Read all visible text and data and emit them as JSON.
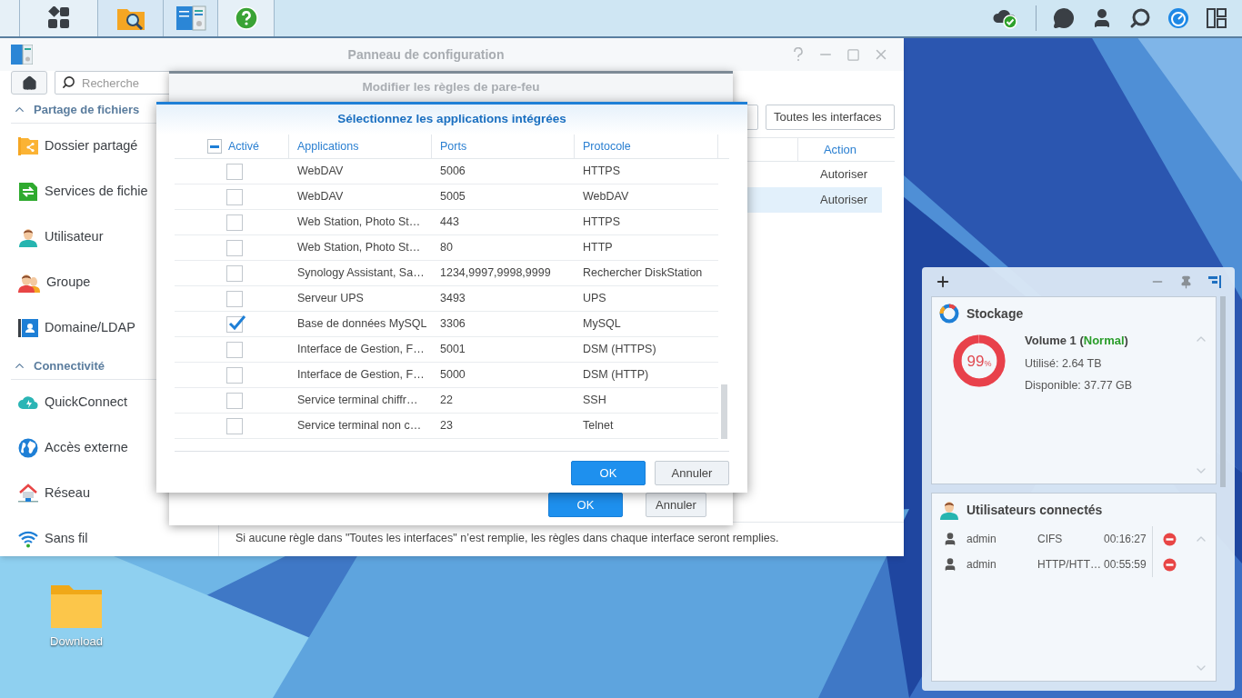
{
  "control_panel": {
    "title": "Panneau de configuration",
    "search": {
      "placeholder": "Recherche"
    },
    "sidebar": [
      {
        "label": "Partage de fichiers",
        "expanded": true,
        "items": [
          {
            "label": "Dossier partagé"
          },
          {
            "label": "Services de fichie"
          },
          {
            "label": "Utilisateur"
          },
          {
            "label": "Groupe"
          },
          {
            "label": "Domaine/LDAP"
          }
        ]
      },
      {
        "label": "Connectivité",
        "expanded": true,
        "items": [
          {
            "label": "QuickConnect"
          },
          {
            "label": "Accès externe"
          },
          {
            "label": "Réseau"
          },
          {
            "label": "Sans fil"
          }
        ]
      }
    ],
    "interface_filter": "Toutes les interfaces",
    "rules": {
      "columns": [
        "Action"
      ],
      "rows": [
        {
          "action": "Autoriser",
          "selected": false
        },
        {
          "action": "Autoriser",
          "selected": true
        }
      ]
    },
    "note": "Si aucune règle dans \"Toutes les interfaces\" n’est remplie, les règles dans chaque interface seront remplies."
  },
  "firewall_dialog": {
    "title": "Modifier les règles de pare-feu",
    "buttons": [
      {
        "label": "OK",
        "kind": "primary"
      },
      {
        "label": "Annuler",
        "kind": "secondary"
      }
    ]
  },
  "apps_dialog": {
    "title": "Sélectionnez les applications intégrées",
    "select_all": {
      "indeterminate": true
    },
    "columns": [
      "Activé",
      "Applications",
      "Ports",
      "Protocole"
    ],
    "rows": [
      {
        "checked": false,
        "application": "WebDAV",
        "ports": "5006",
        "protocol": "HTTPS"
      },
      {
        "checked": false,
        "application": "WebDAV",
        "ports": "5005",
        "protocol": "WebDAV"
      },
      {
        "checked": false,
        "application": "Web Station, Photo St…",
        "ports": "443",
        "protocol": "HTTPS"
      },
      {
        "checked": false,
        "application": "Web Station, Photo St…",
        "ports": "80",
        "protocol": "HTTP"
      },
      {
        "checked": false,
        "application": "Synology Assistant, Sa…",
        "ports": "1234,9997,9998,9999",
        "protocol": "Rechercher DiskStation"
      },
      {
        "checked": false,
        "application": "Serveur UPS",
        "ports": "3493",
        "protocol": "UPS"
      },
      {
        "checked": true,
        "application": "Base de données MySQL",
        "ports": "3306",
        "protocol": "MySQL"
      },
      {
        "checked": false,
        "application": "Interface de Gestion, F…",
        "ports": "5001",
        "protocol": "DSM (HTTPS)"
      },
      {
        "checked": false,
        "application": "Interface de Gestion, F…",
        "ports": "5000",
        "protocol": "DSM (HTTP)"
      },
      {
        "checked": false,
        "application": "Service terminal chiffr…",
        "ports": "22",
        "protocol": "SSH"
      },
      {
        "checked": false,
        "application": "Service terminal non c…",
        "ports": "23",
        "protocol": "Telnet"
      }
    ],
    "buttons": [
      {
        "label": "OK",
        "kind": "primary"
      },
      {
        "label": "Annuler",
        "kind": "secondary"
      }
    ]
  },
  "desktop": {
    "icons": [
      {
        "label": "Download"
      }
    ]
  },
  "widgets": {
    "storage": {
      "title": "Stockage",
      "volume": "Volume 1 (",
      "status": "Normal",
      "volume_end": ")",
      "used": "Utilisé: 2.64 TB",
      "available": "Disponible: 37.77 GB",
      "percent": "99",
      "unit": "%",
      "level": 0.99
    },
    "users": {
      "title": "Utilisateurs connectés",
      "sessions": [
        {
          "user": "admin",
          "protocol": "CIFS",
          "time": "00:16:27"
        },
        {
          "user": "admin",
          "protocol": "HTTP/HTT…",
          "time": "00:55:59"
        }
      ]
    }
  }
}
